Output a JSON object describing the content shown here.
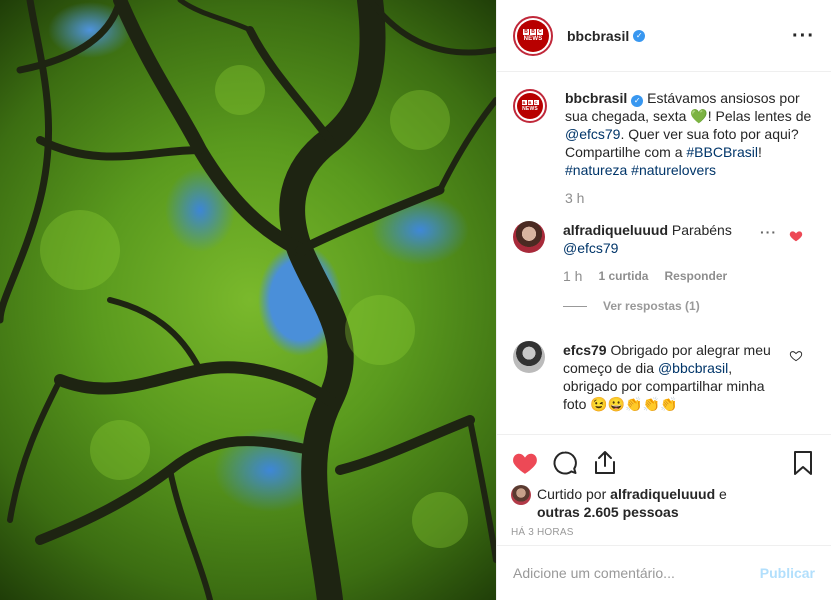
{
  "post": {
    "image_alt": "Árvore vista de baixo com folhas verdes e céu azul",
    "author": "bbcbrasil",
    "avatar_text_boxes": [
      "B",
      "B",
      "C"
    ],
    "avatar_news": "NEWS",
    "more_icon": "more-horizontal-icon"
  },
  "caption": {
    "author": "bbcbrasil",
    "text_1": " Estávamos ansiosos por sua chegada, sexta ",
    "emoji_heart": "💚",
    "text_2": "! Pelas lentes de ",
    "mention": "@efcs79",
    "text_3": ". Quer ver sua foto por aqui? Compartilhe com a ",
    "hashtag_1": "#BBCBrasil",
    "text_4": "! ",
    "hashtag_2": "#natureza",
    "hashtag_3": "#naturelovers",
    "time": "3 h"
  },
  "comments": [
    {
      "user": "alfradiqueluuud",
      "text": " Parabéns ",
      "mention": "@efcs79",
      "time": "1 h",
      "likes": "1 curtida",
      "reply": "Responder",
      "view_replies": "Ver respostas (1)",
      "liked": true,
      "heart_color": "#ed4956"
    },
    {
      "user": "efcs79",
      "text": " Obrigado por alegrar meu começo de dia ",
      "mention": "@bbcbrasil",
      "text_2": ", obrigado por compartilhar minha foto ",
      "emojis": "😉😀👏👏👏",
      "liked": false
    }
  ],
  "actions": {
    "like_icon": "heart-filled-icon",
    "comment_icon": "comment-icon",
    "share_icon": "share-icon",
    "save_icon": "bookmark-icon",
    "liked_color": "#ed4956"
  },
  "likes": {
    "prefix": "Curtido por ",
    "user": "alfradiqueluuud",
    "middle": " e ",
    "others": "outras 2.605 pessoas"
  },
  "timestamp": "HÁ 3 HORAS",
  "add_comment": {
    "placeholder": "Adicione um comentário...",
    "publish": "Publicar"
  }
}
